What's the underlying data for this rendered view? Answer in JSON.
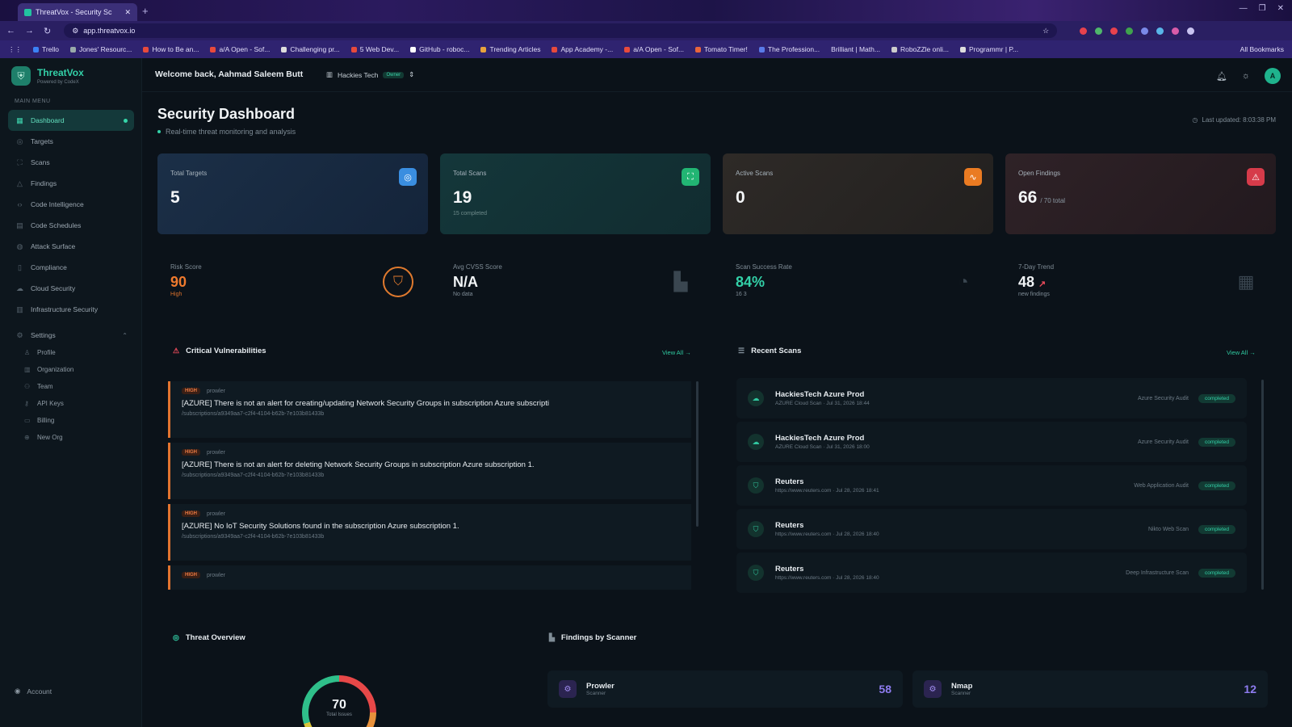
{
  "browser": {
    "tab_title": "ThreatVox - Security Sc",
    "url": "app.threatvox.io",
    "bookmarks": [
      "Trello",
      "Jones' Resourc...",
      "How to Be an...",
      "a/A Open - Sof...",
      "Challenging pr...",
      "5 Web Dev...",
      "GitHub - roboc...",
      "Trending Articles",
      "App Academy -...",
      "a/A Open - Sof...",
      "Tomato Timer!",
      "The Profession...",
      "Brilliant | Math...",
      "RoboZZle onli...",
      "Programmr | P...",
      "All Bookmarks"
    ]
  },
  "sidebar": {
    "brand": "ThreatVox",
    "brand_sub": "Powered by CodeX",
    "menu_head": "MAIN MENU",
    "items": [
      {
        "label": "Dashboard",
        "icon": "grid-icon"
      },
      {
        "label": "Targets",
        "icon": "target-icon"
      },
      {
        "label": "Scans",
        "icon": "scan-icon"
      },
      {
        "label": "Findings",
        "icon": "alert-icon"
      },
      {
        "label": "Code Intelligence",
        "icon": "code-icon"
      },
      {
        "label": "Code Schedules",
        "icon": "calendar-icon"
      },
      {
        "label": "Attack Surface",
        "icon": "globe-icon"
      },
      {
        "label": "Compliance",
        "icon": "document-icon"
      },
      {
        "label": "Cloud Security",
        "icon": "cloud-icon"
      },
      {
        "label": "Infrastructure Security",
        "icon": "server-icon"
      }
    ],
    "settings_label": "Settings",
    "settings_items": [
      "Profile",
      "Organization",
      "Team",
      "API Keys",
      "Billing",
      "New Org"
    ],
    "account_label": "Account"
  },
  "topbar": {
    "welcome": "Welcome back, Aahmad Saleem Butt",
    "org": "Hackies Tech",
    "org_badge": "Owner"
  },
  "page": {
    "title": "Security Dashboard",
    "subtitle": "Real-time threat monitoring and analysis",
    "updated": "Last updated: 8:03:38 PM"
  },
  "cards": [
    {
      "label": "Total Targets",
      "value": "5",
      "note": "",
      "suffix": ""
    },
    {
      "label": "Total Scans",
      "value": "19",
      "note": "15 completed",
      "suffix": ""
    },
    {
      "label": "Active Scans",
      "value": "0",
      "note": "",
      "suffix": ""
    },
    {
      "label": "Open Findings",
      "value": "66",
      "note": "",
      "suffix": "/ 70 total"
    }
  ],
  "metrics": [
    {
      "label": "Risk Score",
      "value": "90",
      "note": "High"
    },
    {
      "label": "Avg CVSS Score",
      "value": "N/A",
      "note": "No data"
    },
    {
      "label": "Scan Success Rate",
      "value": "84%",
      "note": "16  3"
    },
    {
      "label": "7-Day Trend",
      "value": "48",
      "note": "new findings"
    }
  ],
  "critical": {
    "title": "Critical Vulnerabilities",
    "view_all": "View All →",
    "items": [
      {
        "severity": "HIGH",
        "source": "prowler",
        "title": "[AZURE] There is not an alert for creating/updating Network Security Groups in subscription Azure subscripti",
        "path": "/subscriptions/a9349aa7-c2f4-4104-b62b-7e103b81433b"
      },
      {
        "severity": "HIGH",
        "source": "prowler",
        "title": "[AZURE] There is not an alert for deleting Network Security Groups in subscription Azure subscription 1.",
        "path": "/subscriptions/a9349aa7-c2f4-4104-b62b-7e103b81433b"
      },
      {
        "severity": "HIGH",
        "source": "prowler",
        "title": "[AZURE] No IoT Security Solutions found in the subscription Azure subscription 1.",
        "path": "/subscriptions/a9349aa7-c2f4-4104-b62b-7e103b81433b"
      },
      {
        "severity": "HIGH",
        "source": "prowler",
        "title": "",
        "path": ""
      }
    ]
  },
  "recent": {
    "title": "Recent Scans",
    "view_all": "View All →",
    "items": [
      {
        "name": "HackiesTech Azure Prod",
        "meta": "AZURE Cloud Scan · Jul 31, 2026 18:44",
        "type": "Azure Security Audit",
        "status": "completed"
      },
      {
        "name": "HackiesTech Azure Prod",
        "meta": "AZURE Cloud Scan · Jul 31, 2026 18:00",
        "type": "Azure Security Audit",
        "status": "completed"
      },
      {
        "name": "Reuters",
        "meta": "https://www.reuters.com · Jul 28, 2026 18:41",
        "type": "Web Application Audit",
        "status": "completed"
      },
      {
        "name": "Reuters",
        "meta": "https://www.reuters.com · Jul 28, 2026 18:40",
        "type": "Nikto Web Scan",
        "status": "completed"
      },
      {
        "name": "Reuters",
        "meta": "https://www.reuters.com · Jul 28, 2026 18:40",
        "type": "Deep Infrastructure Scan",
        "status": "completed"
      }
    ]
  },
  "threat": {
    "title": "Threat Overview",
    "total": "70",
    "total_label": "Total Issues"
  },
  "scanners": {
    "title": "Findings by Scanner",
    "items": [
      {
        "name": "Prowler",
        "sub": "Scanner",
        "count": "58"
      },
      {
        "name": "Nmap",
        "sub": "Scanner",
        "count": "12"
      }
    ]
  }
}
